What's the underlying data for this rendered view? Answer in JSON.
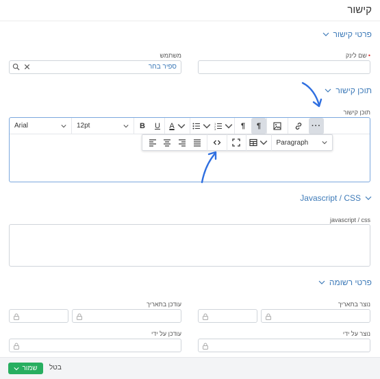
{
  "page": {
    "title": "קישור"
  },
  "sections": {
    "link_details": "פרטי קישור",
    "link_content": "תוכן קישור",
    "js_css": "Javascript / CSS",
    "record_details": "פרטי רשומה"
  },
  "fields": {
    "link_name": {
      "label": "שם לינק",
      "value": ""
    },
    "user": {
      "label": "משתמש",
      "value": "ספיר בחר"
    },
    "link_content": {
      "label": "תוכן קישור"
    },
    "javascript_css": {
      "label": "javascript / css",
      "value": ""
    },
    "created_on": {
      "label": "נוצר בתאריך"
    },
    "edited_on": {
      "label": "עודכן בתאריך"
    },
    "created_by": {
      "label": "נוצר על ידי"
    },
    "edited_by": {
      "label": "עודכן על ידי"
    }
  },
  "editor": {
    "font_family": "Arial",
    "font_size": "12pt",
    "block_format": "Paragraph",
    "toolbar_icons": [
      "bold-icon",
      "underline-icon",
      "text-color-icon",
      "bullet-list-icon",
      "numbered-list-icon",
      "ltr-icon",
      "rtl-icon",
      "image-icon",
      "link-icon",
      "more-icon"
    ],
    "floating_icons": [
      "align-left-icon",
      "align-center-icon",
      "align-right-icon",
      "justify-icon",
      "code-icon",
      "fullscreen-icon",
      "table-icon"
    ]
  },
  "footer": {
    "save_label": "שמור",
    "cancel_label": "בטל"
  },
  "colors": {
    "accent": "#3d7ab8",
    "save": "#27ae60",
    "focus_border": "#7aa7dd"
  }
}
